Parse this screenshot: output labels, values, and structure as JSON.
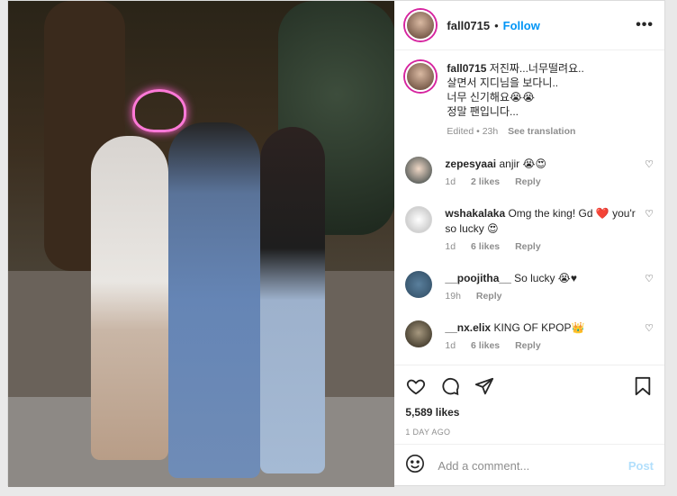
{
  "post": {
    "username": "fall0715",
    "follow_label": "Follow",
    "more_icon": "more-options-icon",
    "caption_text": "저진짜...너무떨려요..\n살면서 지디님을 보다니..\n너무 신기해요😭😭\n정말 팬입니다...",
    "caption_time": "Edited • 23h",
    "see_translation": "See translation"
  },
  "comments": [
    {
      "user": "zepesyaai",
      "text": "anjir 😭😍",
      "age": "1d",
      "likes": "2 likes",
      "reply": "Reply"
    },
    {
      "user": "wshakalaka",
      "text": "Omg the king! Gd ❤️ you'r so lucky 😍",
      "age": "1d",
      "likes": "6 likes",
      "reply": "Reply"
    },
    {
      "user": "__poojitha__",
      "text": "So lucky 😭♥",
      "age": "19h",
      "likes": "",
      "reply": "Reply"
    },
    {
      "user": "__nx.elix",
      "text": "KING OF KPOP👑",
      "age": "1d",
      "likes": "6 likes",
      "reply": "Reply"
    }
  ],
  "actions": {
    "likes_count": "5,589 likes",
    "date": "1 DAY AGO"
  },
  "add_comment": {
    "placeholder": "Add a comment...",
    "post_label": "Post"
  }
}
